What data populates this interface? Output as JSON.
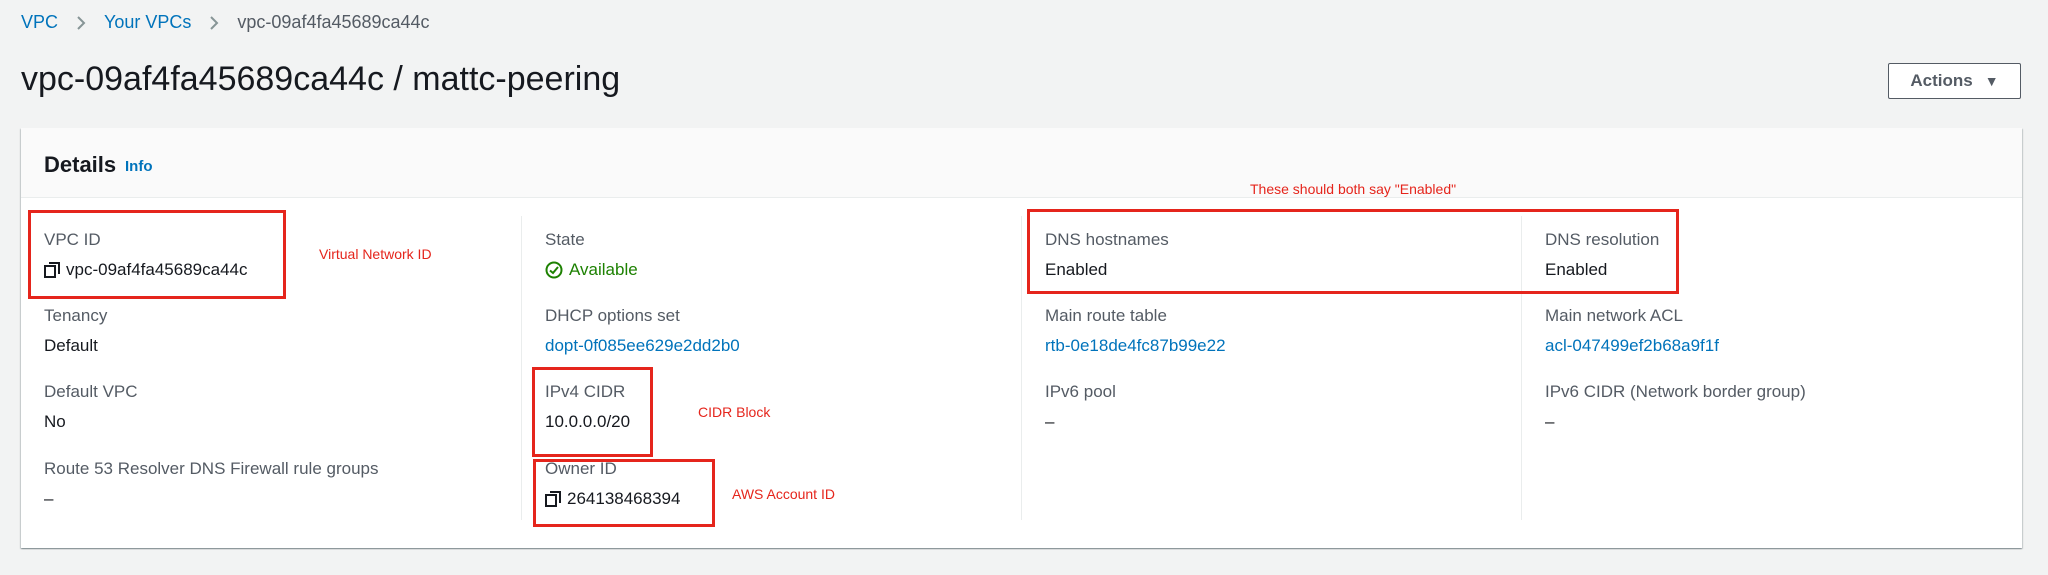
{
  "breadcrumb": {
    "items": [
      {
        "label": "VPC"
      },
      {
        "label": "Your VPCs"
      }
    ],
    "current": "vpc-09af4fa45689ca44c"
  },
  "page_title": "vpc-09af4fa45689ca44c / mattc-peering",
  "actions_button": "Actions",
  "panel": {
    "title": "Details",
    "info": "Info"
  },
  "fields": {
    "vpc_id": {
      "label": "VPC ID",
      "value": "vpc-09af4fa45689ca44c"
    },
    "tenancy": {
      "label": "Tenancy",
      "value": "Default"
    },
    "default_vpc": {
      "label": "Default VPC",
      "value": "No"
    },
    "route53": {
      "label": "Route 53 Resolver DNS Firewall rule groups",
      "value": "–"
    },
    "state": {
      "label": "State",
      "value": "Available"
    },
    "dhcp": {
      "label": "DHCP options set",
      "value": "dopt-0f085ee629e2dd2b0"
    },
    "ipv4_cidr": {
      "label": "IPv4 CIDR",
      "value": "10.0.0.0/20"
    },
    "owner_id": {
      "label": "Owner ID",
      "value": "264138468394"
    },
    "dns_hostnames": {
      "label": "DNS hostnames",
      "value": "Enabled"
    },
    "main_route_table": {
      "label": "Main route table",
      "value": "rtb-0e18de4fc87b99e22"
    },
    "ipv6_pool": {
      "label": "IPv6 pool",
      "value": "–"
    },
    "dns_resolution": {
      "label": "DNS resolution",
      "value": "Enabled"
    },
    "main_acl": {
      "label": "Main network ACL",
      "value": "acl-047499ef2b68a9f1f"
    },
    "ipv6_cidr": {
      "label": "IPv6 CIDR (Network border group)",
      "value": "–"
    }
  },
  "annotations": {
    "virtual_network_id": "Virtual Network ID",
    "cidr_block": "CIDR Block",
    "aws_account_id": "AWS  Account ID",
    "dns_note": "These should both say \"Enabled\""
  },
  "colors": {
    "link": "#0073bb",
    "success": "#1d8102",
    "annotation": "#e5251c"
  }
}
